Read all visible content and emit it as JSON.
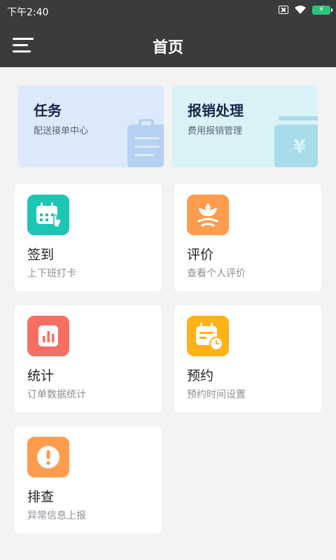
{
  "status_bar": {
    "time": "下午2:40"
  },
  "header": {
    "title": "首页"
  },
  "banners": [
    {
      "title": "任务",
      "subtitle": "配送接单中心",
      "color": "#dbe9fb"
    },
    {
      "title": "报销处理",
      "subtitle": "费用报销管理",
      "color": "#d9f2f7"
    }
  ],
  "cards": [
    {
      "title": "签到",
      "subtitle": "上下班打卡",
      "icon": "calendar-check-icon",
      "color": "#1dc6b3"
    },
    {
      "title": "评价",
      "subtitle": "查看个人评价",
      "icon": "flower-icon",
      "color": "#ff9c4d"
    },
    {
      "title": "统计",
      "subtitle": "订单数据统计",
      "icon": "bar-chart-icon",
      "color": "#f46f62"
    },
    {
      "title": "预约",
      "subtitle": "预约时间设置",
      "icon": "calendar-clock-icon",
      "color": "#ffb11a"
    },
    {
      "title": "排查",
      "subtitle": "异常信息上报",
      "icon": "alert-icon",
      "color": "#ff9c4d"
    }
  ]
}
